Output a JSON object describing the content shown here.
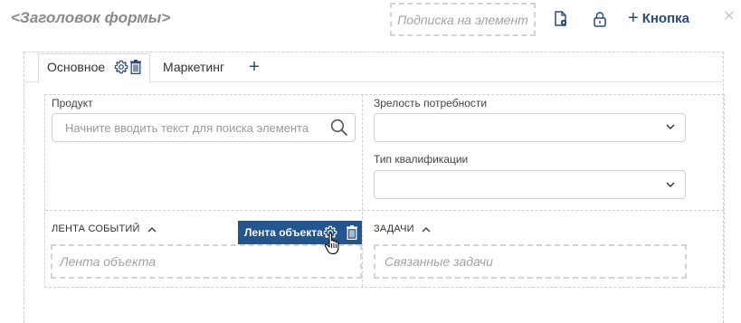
{
  "header": {
    "title": "<Заголовок формы>",
    "subscribe_placeholder": "Подписка на элемент",
    "add_button_label": "Кнопка"
  },
  "tabs": [
    {
      "label": "Основное",
      "active": true
    },
    {
      "label": "Маркетинг",
      "active": false
    }
  ],
  "fields": {
    "product": {
      "label": "Продукт",
      "placeholder": "Начните вводить текст для поиска элемента"
    },
    "need_maturity": {
      "label": "Зрелость потребности",
      "value": ""
    },
    "qualification_type": {
      "label": "Тип квалификации",
      "value": ""
    }
  },
  "sections": {
    "event_feed": {
      "title": "ЛЕНТА СОБЫТИЙ",
      "placeholder": "Лента объекта"
    },
    "tasks": {
      "title": "ЗАДАЧИ",
      "placeholder": "Связанные задачи"
    }
  },
  "tooltip": {
    "label": "Лента объекта"
  },
  "colors": {
    "accent": "#2a4a78",
    "tooltip_bg": "#24558c",
    "placeholder": "#a3a3a3"
  }
}
